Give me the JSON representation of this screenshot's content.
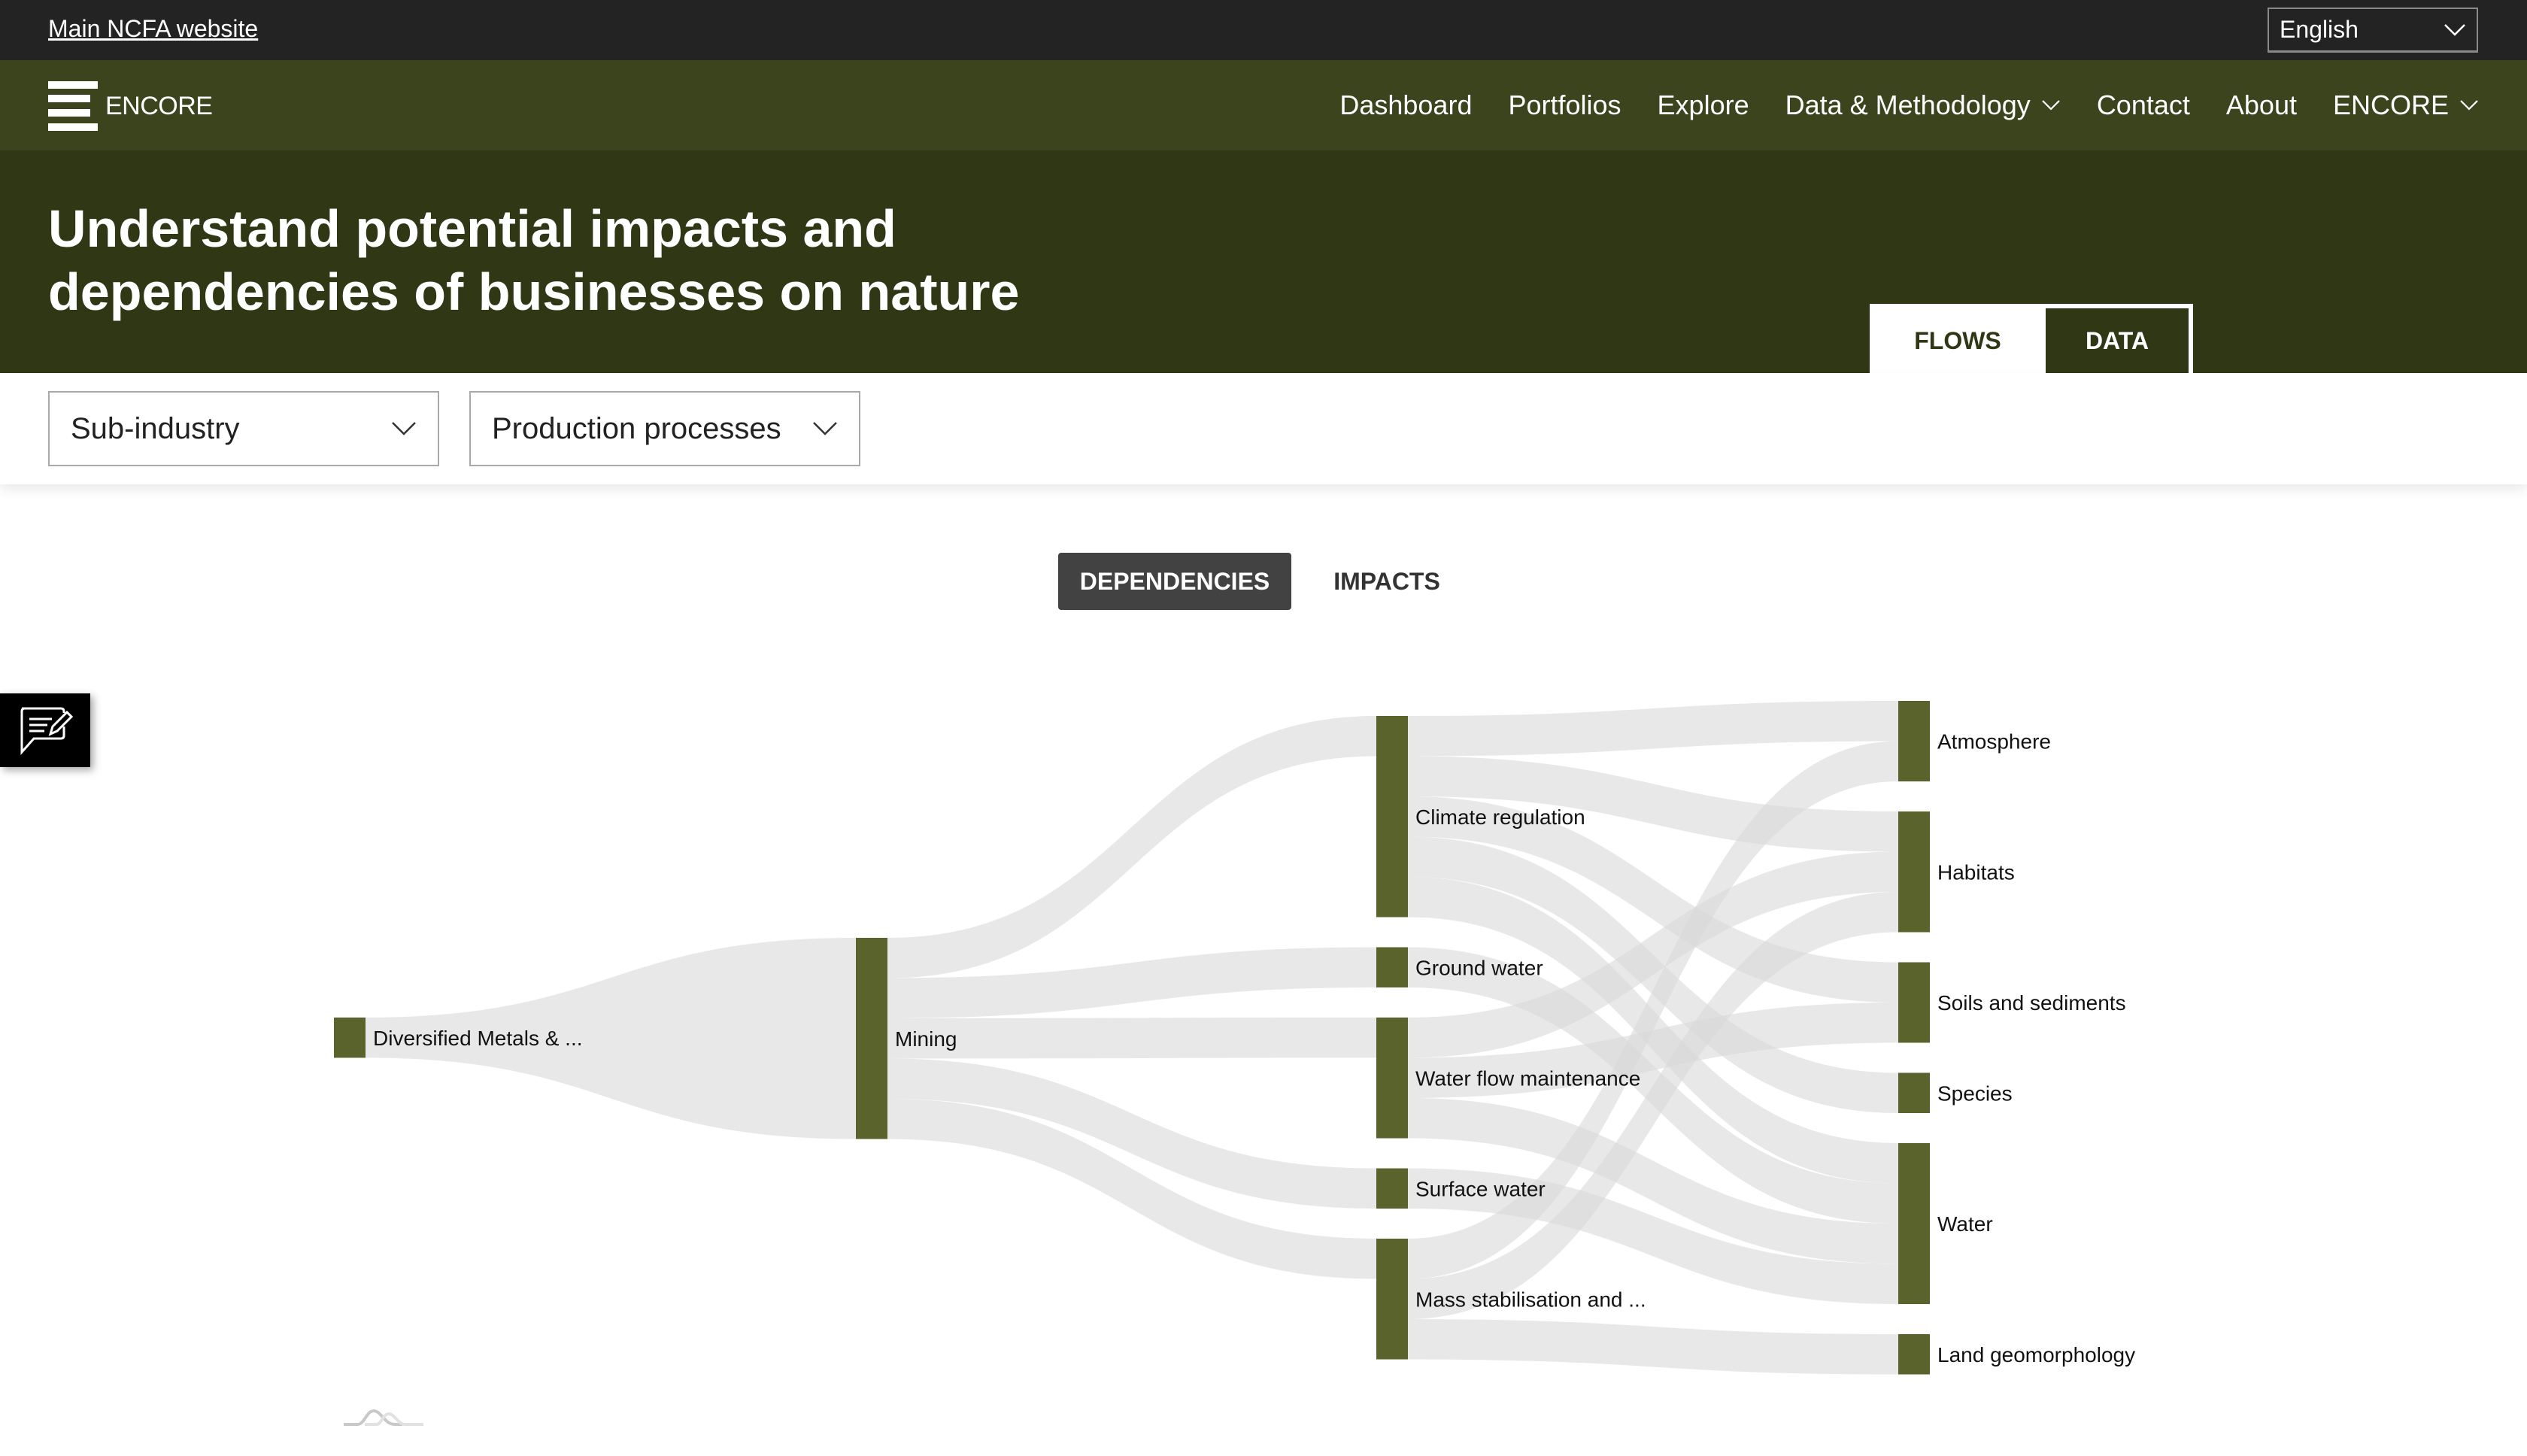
{
  "topbar": {
    "main_link": "Main NCFA website",
    "language": "English"
  },
  "navbar": {
    "logo_text": "ENCORE",
    "items": [
      {
        "label": "Dashboard",
        "has_dropdown": false
      },
      {
        "label": "Portfolios",
        "has_dropdown": false
      },
      {
        "label": "Explore",
        "has_dropdown": false
      },
      {
        "label": "Data & Methodology",
        "has_dropdown": true
      },
      {
        "label": "Contact",
        "has_dropdown": false
      },
      {
        "label": "About",
        "has_dropdown": false
      },
      {
        "label": "ENCORE",
        "has_dropdown": true
      }
    ]
  },
  "hero": {
    "title": "Understand potential impacts and dependencies of businesses on nature",
    "tabs": [
      {
        "label": "FLOWS",
        "active": true
      },
      {
        "label": "DATA",
        "active": false
      }
    ]
  },
  "filters": {
    "sub_industry": "Sub-industry",
    "production_processes": "Production processes"
  },
  "toggle": {
    "dependencies": "DEPENDENCIES",
    "impacts": "IMPACTS",
    "active": "dependencies"
  },
  "icons": {
    "feedback": "feedback-edit-icon",
    "loader": "loading-waves-icon",
    "chevron": "chevron-down-icon"
  },
  "colors": {
    "topbar": "#232323",
    "navbar": "#3b441d",
    "hero": "#2f3714",
    "node": "#5a632c",
    "link": "#d9d9d9",
    "toggle_active": "#424242"
  },
  "chart_data": {
    "type": "sankey",
    "title": "",
    "columns": [
      [
        "Diversified Metals & ..."
      ],
      [
        "Mining"
      ],
      [
        "Climate regulation",
        "Ground water",
        "Water flow maintenance",
        "Surface water",
        "Mass stabilisation and ..."
      ],
      [
        "Atmosphere",
        "Habitats",
        "Soils and sediments",
        "Species",
        "Water",
        "Land geomorphology"
      ]
    ],
    "node_values": {
      "Diversified Metals & ...": 1,
      "Mining": 5,
      "Climate regulation": 5,
      "Ground water": 1,
      "Water flow maintenance": 3,
      "Surface water": 1,
      "Mass stabilisation and ...": 3,
      "Atmosphere": 2,
      "Habitats": 3,
      "Soils and sediments": 2,
      "Species": 1,
      "Water": 4,
      "Land geomorphology": 1
    },
    "links": [
      {
        "source": "Diversified Metals & ...",
        "target": "Mining",
        "value": 1
      },
      {
        "source": "Mining",
        "target": "Climate regulation",
        "value": 1
      },
      {
        "source": "Mining",
        "target": "Ground water",
        "value": 1
      },
      {
        "source": "Mining",
        "target": "Water flow maintenance",
        "value": 1
      },
      {
        "source": "Mining",
        "target": "Surface water",
        "value": 1
      },
      {
        "source": "Mining",
        "target": "Mass stabilisation and ...",
        "value": 1
      },
      {
        "source": "Climate regulation",
        "target": "Atmosphere",
        "value": 1
      },
      {
        "source": "Climate regulation",
        "target": "Habitats",
        "value": 1
      },
      {
        "source": "Climate regulation",
        "target": "Soils and sediments",
        "value": 1
      },
      {
        "source": "Climate regulation",
        "target": "Species",
        "value": 1
      },
      {
        "source": "Climate regulation",
        "target": "Water",
        "value": 1
      },
      {
        "source": "Ground water",
        "target": "Water",
        "value": 1
      },
      {
        "source": "Water flow maintenance",
        "target": "Habitats",
        "value": 1
      },
      {
        "source": "Water flow maintenance",
        "target": "Soils and sediments",
        "value": 1
      },
      {
        "source": "Water flow maintenance",
        "target": "Water",
        "value": 1
      },
      {
        "source": "Surface water",
        "target": "Water",
        "value": 1
      },
      {
        "source": "Mass stabilisation and ...",
        "target": "Atmosphere",
        "value": 1
      },
      {
        "source": "Mass stabilisation and ...",
        "target": "Habitats",
        "value": 1
      },
      {
        "source": "Mass stabilisation and ...",
        "target": "Land geomorphology",
        "value": 1
      }
    ]
  }
}
